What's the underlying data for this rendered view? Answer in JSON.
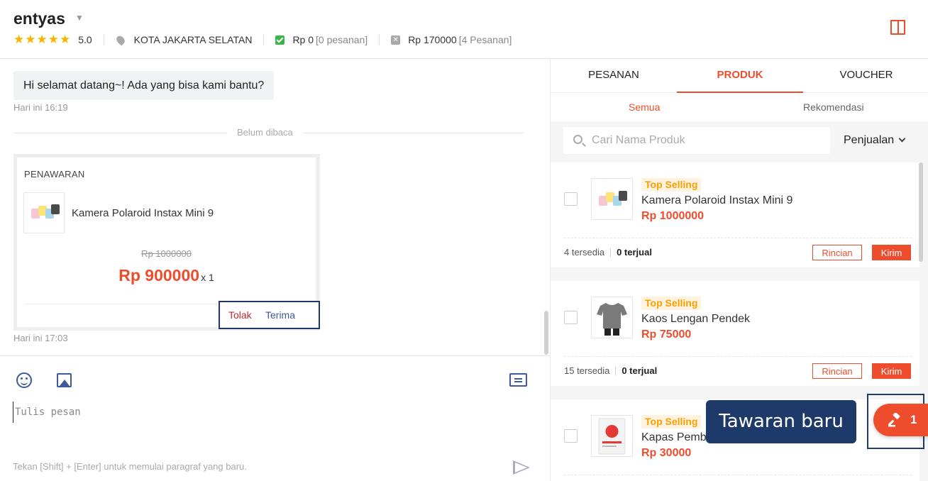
{
  "header": {
    "shop_name": "entyas",
    "stars": "★★★★★",
    "rating": "5.0",
    "location": "KOTA JAKARTA SELATAN",
    "paid_amount": "Rp 0",
    "paid_orders": "[0 pesanan]",
    "unpaid_amount": "Rp 170000",
    "unpaid_orders": "[4 Pesanan]"
  },
  "chat": {
    "greeting": "Hi selamat datang~! Ada yang bisa kami bantu?",
    "greeting_time": "Hari ini 16:19",
    "unread_label": "Belum dibaca",
    "offer": {
      "title": "PENAWARAN",
      "product_name": "Kamera Polaroid Instax Mini 9",
      "old_price": "Rp 1000000",
      "new_price": "Rp 900000",
      "quantity": "x 1",
      "reject_label": "Tolak",
      "accept_label": "Terima"
    },
    "offer_time": "Hari ini 17:03"
  },
  "composer": {
    "placeholder": "Tulis pesan",
    "hint": "Tekan [Shift] + [Enter] untuk memulai paragraf yang baru."
  },
  "panel": {
    "tabs": [
      "PESANAN",
      "PRODUK",
      "VOUCHER"
    ],
    "active_tab": "PRODUK",
    "subtabs": [
      "Semua",
      "Rekomendasi"
    ],
    "search_placeholder": "Cari Nama Produk",
    "sort_label": "Penjualan",
    "products": [
      {
        "badge": "Top Selling",
        "name": "Kamera Polaroid Instax Mini 9",
        "price": "Rp 1000000",
        "stock": "4 tersedia",
        "sold": "0 terjual",
        "detail_label": "Rincian",
        "send_label": "Kirim"
      },
      {
        "badge": "Top Selling",
        "name": "Kaos Lengan Pendek",
        "price": "Rp 75000",
        "stock": "15 tersedia",
        "sold": "0 terjual",
        "detail_label": "Rincian",
        "send_label": "Kirim"
      },
      {
        "badge": "Top Selling",
        "name": "Kapas Pembe",
        "price": "Rp 30000"
      }
    ]
  },
  "tooltip": {
    "text": "Tawaran baru"
  },
  "offers_fab": {
    "count": "1"
  },
  "colors": {
    "accent": "#ee4d2d",
    "highlight": "#1d3a6b",
    "star": "#f7b500",
    "badge": "#f7a000"
  }
}
